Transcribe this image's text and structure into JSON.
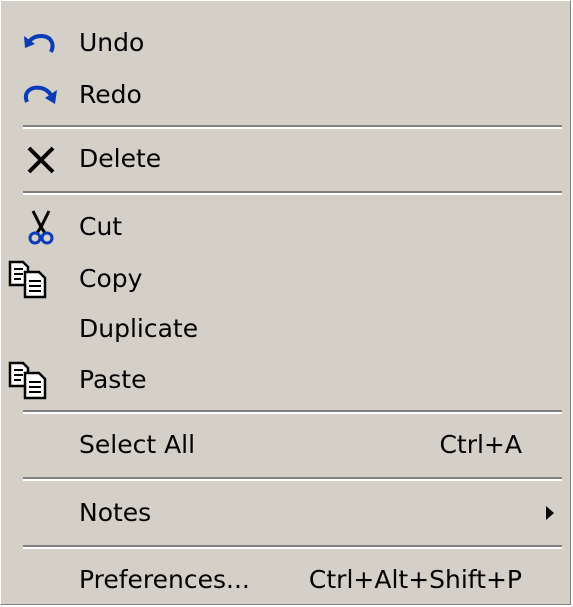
{
  "menu": {
    "undo": {
      "label": "Undo",
      "icon": "undo-icon"
    },
    "redo": {
      "label": "Redo",
      "icon": "redo-icon"
    },
    "delete": {
      "label": "Delete",
      "icon": "delete-icon"
    },
    "cut": {
      "label": "Cut",
      "icon": "scissors-icon"
    },
    "copy": {
      "label": "Copy",
      "icon": "copy-icon"
    },
    "duplicate": {
      "label": "Duplicate"
    },
    "paste": {
      "label": "Paste",
      "icon": "paste-icon"
    },
    "select_all": {
      "label": "Select All",
      "shortcut": "Ctrl+A"
    },
    "notes": {
      "label": "Notes",
      "icon": "submenu-arrow-icon"
    },
    "preferences": {
      "label": "Preferences...",
      "shortcut": "Ctrl+Alt+Shift+P"
    }
  },
  "colors": {
    "menu_background": "#d4d0c8",
    "separator_shadow": "#808080",
    "separator_highlight": "#ffffff",
    "icon_blue": "#0a3cb8"
  }
}
